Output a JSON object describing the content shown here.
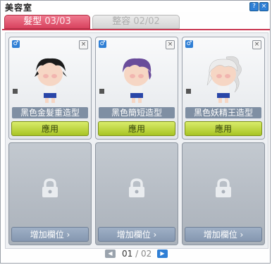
{
  "window": {
    "title": "美容室"
  },
  "tabs": [
    {
      "label": "髮型",
      "count": "03/03",
      "active": true
    },
    {
      "label": "整容",
      "count": "02/02",
      "active": false
    }
  ],
  "cards": [
    {
      "name": "黑色金髮重造型",
      "action": "應用",
      "hair_color": "#1b1b1b"
    },
    {
      "name": "黑色簡短造型",
      "action": "應用",
      "hair_color": "#6a4c9a"
    },
    {
      "name": "黑色妖精王造型",
      "action": "應用",
      "hair_color": "#e6e6e6"
    }
  ],
  "locked_slot_label": "增加欄位 ›",
  "pagination": {
    "current": "01",
    "separator": "/",
    "total": "02"
  },
  "colors": {
    "accent": "#d8425e",
    "apply": "#a8c424",
    "gender": "#2f7fd5"
  }
}
